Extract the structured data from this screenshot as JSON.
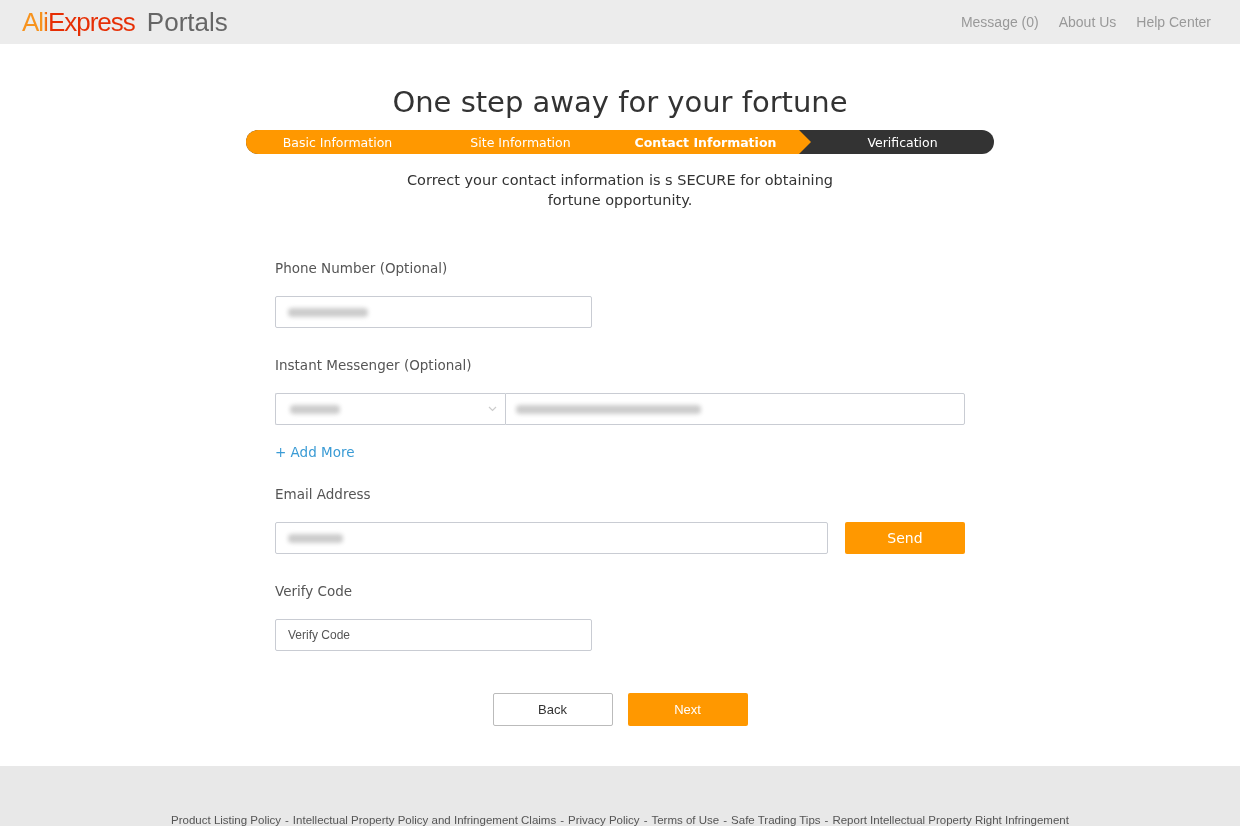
{
  "header": {
    "logo": {
      "brand": "AliExpress",
      "product": "Portals"
    },
    "nav": [
      "Message (0)",
      "About Us",
      "Help Center"
    ]
  },
  "title": "One step away for your fortune",
  "steps": [
    {
      "label": "Basic Information",
      "completed": true,
      "selected": false
    },
    {
      "label": "Site Information",
      "completed": true,
      "selected": false
    },
    {
      "label": "Contact Information",
      "completed": false,
      "selected": true
    },
    {
      "label": "Verification",
      "completed": false,
      "selected": false
    }
  ],
  "intro": "Correct your contact information is s SECURE for obtaining fortune opportunity.",
  "form": {
    "phone": {
      "label": "Phone Number (Optional)",
      "redacted": true
    },
    "messenger": {
      "label": "Instant Messenger (Optional)",
      "select_redacted": true,
      "account_redacted": true,
      "add_more": "+ Add More"
    },
    "email": {
      "label": "Email Address",
      "redacted": true,
      "send": "Send"
    },
    "verify": {
      "label": "Verify Code",
      "placeholder": "Verify Code"
    }
  },
  "buttons": [
    {
      "label": "Back",
      "kind": "secondary"
    },
    {
      "label": "Next",
      "kind": "primary"
    }
  ],
  "footer_separator": "-",
  "footer_links": [
    "Product Listing Policy",
    "Intellectual Property Policy and Infringement Claims",
    "Privacy Policy",
    "Terms of Use",
    "Safe Trading Tips",
    "Report Intellectual Property Right Infringement"
  ]
}
